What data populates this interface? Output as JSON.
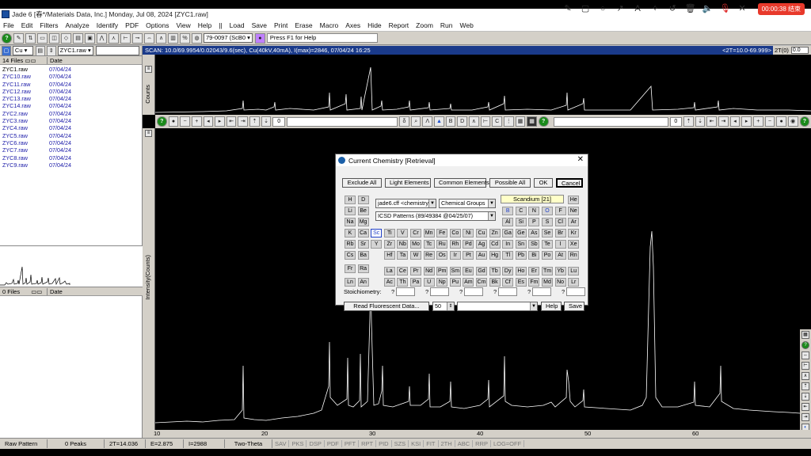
{
  "window": {
    "title": "Jade 6 [春*/Materials Data, Inc.] Monday, Jul 08, 2024 [ZYC1.raw]"
  },
  "recorder": {
    "timer": "00:00:38 结束"
  },
  "menu": [
    "File",
    "Edit",
    "Filters",
    "Analyze",
    "Identify",
    "PDF",
    "Options",
    "View",
    "Help",
    "||",
    "Load",
    "Save",
    "Print",
    "Erase",
    "Macro",
    "Axes",
    "Hide",
    "Report",
    "Zoom",
    "Run",
    "Web"
  ],
  "toolbar": {
    "pattern_combo": "79-0097 (ScB0",
    "hint": "Press F1 for Help"
  },
  "left_panel": {
    "element_combo": "Cu",
    "file_combo": "ZYC1.raw",
    "files_header": "14 Files",
    "date_header": "Date",
    "files": [
      {
        "name": "ZYC1.raw",
        "date": "07/04/24"
      },
      {
        "name": "ZYC10.raw",
        "date": "07/04/24"
      },
      {
        "name": "ZYC11.raw",
        "date": "07/04/24"
      },
      {
        "name": "ZYC12.raw",
        "date": "07/04/24"
      },
      {
        "name": "ZYC13.raw",
        "date": "07/04/24"
      },
      {
        "name": "ZYC14.raw",
        "date": "07/04/24"
      },
      {
        "name": "ZYC2.raw",
        "date": "07/04/24"
      },
      {
        "name": "ZYC3.raw",
        "date": "07/04/24"
      },
      {
        "name": "ZYC4.raw",
        "date": "07/04/24"
      },
      {
        "name": "ZYC5.raw",
        "date": "07/04/24"
      },
      {
        "name": "ZYC6.raw",
        "date": "07/04/24"
      },
      {
        "name": "ZYC7.raw",
        "date": "07/04/24"
      },
      {
        "name": "ZYC8.raw",
        "date": "07/04/24"
      },
      {
        "name": "ZYC9.raw",
        "date": "07/04/24"
      }
    ],
    "files2_header": "0 Files",
    "date2_header": "Date"
  },
  "scan": {
    "info": "SCAN: 10.0/69.9954/0.02043/9.6(sec), Cu(40kV,40mA), I(max)=2846, 07/04/24 16:25",
    "range_readout": "<2T=10.0-69.999>",
    "two_theta_label": "2T(0)",
    "two_theta_value": "0.0",
    "counts_label": "Counts",
    "intensity_label": "Intensity(Counts)",
    "mid_value_left": "0",
    "mid_value_right": "0"
  },
  "x_axis": [
    "10",
    "20",
    "30",
    "40",
    "50",
    "60"
  ],
  "dialog": {
    "title": "Current Chemistry [Retrieval]",
    "buttons": {
      "exclude_all": "Exclude All",
      "light_elements": "Light Elements",
      "common_elements": "Common Elements",
      "possible_all": "Possible All",
      "ok": "OK",
      "cancel": "Cancel"
    },
    "db_combo": "jade6.cff <chemistry",
    "group_combo": "Chemical Groups",
    "icsd_combo": "ICSD Patterns (89/49384 @04/25/07)",
    "selected_element": "Scandium [21]",
    "stoichiometry_label": "Stoichiometry:",
    "read_fluorescent": "Read Fluorescent Data...",
    "count_value": "50",
    "help": "Help",
    "save": "Save"
  },
  "status": {
    "mode": "Raw Pattern",
    "peaks": "0 Peaks",
    "two_theta": "2T=14.036",
    "energy": "E=2.875",
    "intensity": "I=2988",
    "axis_type": "Two-Theta",
    "flags": [
      "SAV",
      "PKS",
      "DSP",
      "PDF",
      "PFT",
      "RPT",
      "PID",
      "SZS",
      "KSI",
      "FIT",
      "2TH",
      "ABC",
      "RRP",
      "LOG=OFF"
    ]
  }
}
